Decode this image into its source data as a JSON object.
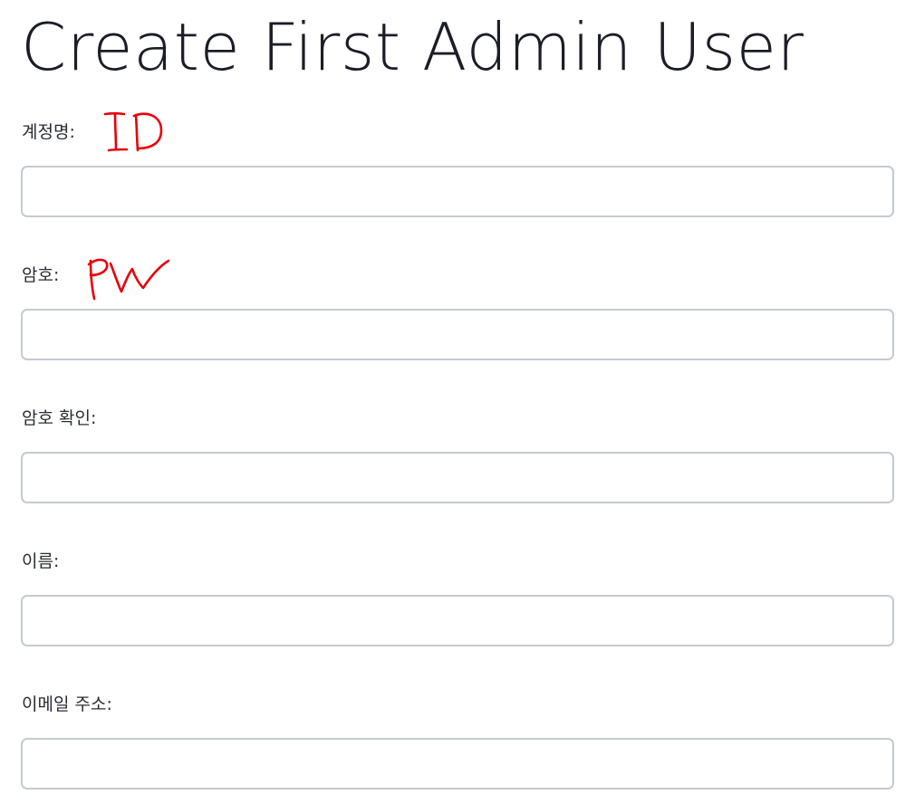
{
  "page": {
    "title": "Create First Admin User"
  },
  "form": {
    "fields": [
      {
        "label": "계정명:",
        "value": ""
      },
      {
        "label": "암호:",
        "value": ""
      },
      {
        "label": "암호 확인:",
        "value": ""
      },
      {
        "label": "이름:",
        "value": ""
      },
      {
        "label": "이메일 주소:",
        "value": ""
      }
    ]
  },
  "annotations": {
    "color": "#e8000b",
    "items": [
      {
        "text": "ID",
        "refers_to": "계정명:"
      },
      {
        "text": "PW",
        "refers_to": "암호:"
      }
    ]
  }
}
